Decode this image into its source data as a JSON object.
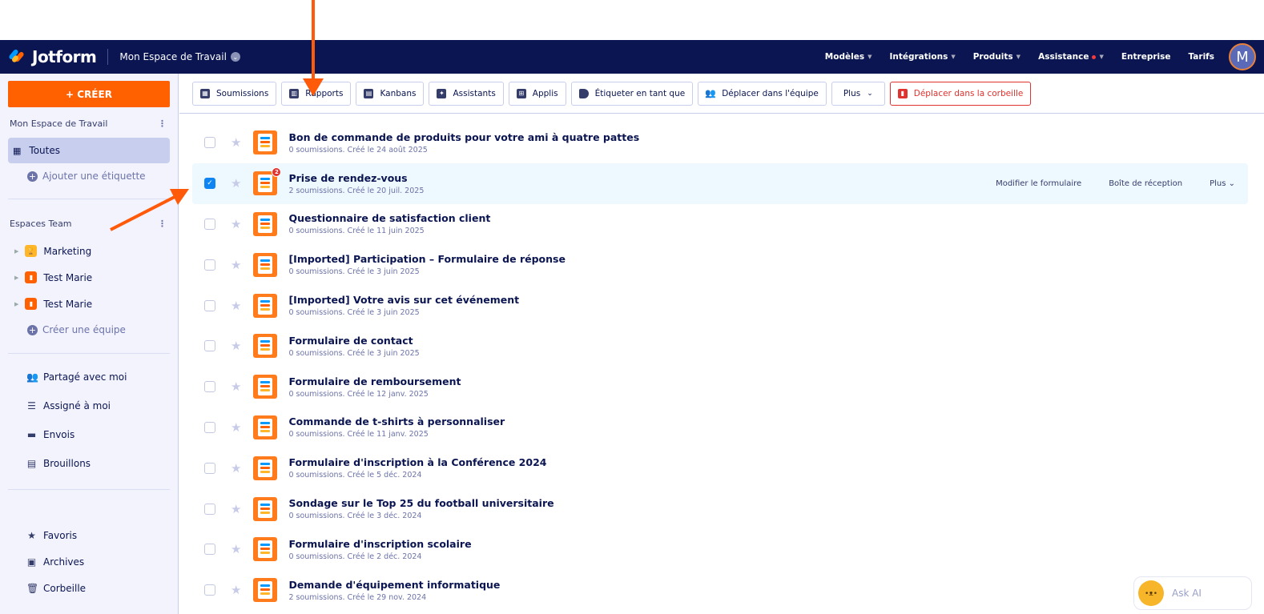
{
  "header": {
    "brand": "Jotform",
    "workspace": "Mon Espace de Travail",
    "nav": [
      "Modèles",
      "Intégrations",
      "Produits",
      "Assistance",
      "Entreprise",
      "Tarifs"
    ],
    "avatar": "M"
  },
  "sidebar": {
    "create": "+ CRÉER",
    "workspace_title": "Mon Espace de Travail",
    "all": "Toutes",
    "add_label": "Ajouter une étiquette",
    "teams_title": "Espaces Team",
    "teams": [
      "Marketing",
      "Test Marie",
      "Test Marie"
    ],
    "create_team": "Créer une équipe",
    "links": [
      "Partagé avec moi",
      "Assigné à moi",
      "Envois",
      "Brouillons"
    ],
    "bottom": [
      "Favoris",
      "Archives",
      "Corbeille"
    ]
  },
  "toolbar": [
    "Soumissions",
    "Rapports",
    "Kanbans",
    "Assistants",
    "Applis",
    "Étiqueter en tant que",
    "Déplacer dans l'équipe",
    "Plus",
    "Déplacer dans la corbeille"
  ],
  "forms": [
    {
      "title": "Bon de commande de produits pour votre ami à quatre pattes",
      "sub": "0 soumissions. Créé le 24 août 2025"
    },
    {
      "title": "Prise de rendez-vous",
      "sub": "2 soumissions. Créé le 20 juil. 2025",
      "badge": "2",
      "selected": true
    },
    {
      "title": "Questionnaire de satisfaction client",
      "sub": "0 soumissions. Créé le 11 juin 2025"
    },
    {
      "title": "[Imported] Participation – Formulaire de réponse",
      "sub": "0 soumissions. Créé le 3 juin 2025"
    },
    {
      "title": "[Imported] Votre avis sur cet événement",
      "sub": "0 soumissions. Créé le 3 juin 2025"
    },
    {
      "title": "Formulaire de contact",
      "sub": "0 soumissions. Créé le 3 juin 2025"
    },
    {
      "title": "Formulaire de remboursement",
      "sub": "0 soumissions. Créé le 12 janv. 2025"
    },
    {
      "title": "Commande de t-shirts à personnaliser",
      "sub": "0 soumissions. Créé le 11 janv. 2025"
    },
    {
      "title": "Formulaire d'inscription à la Conférence 2024",
      "sub": "0 soumissions. Créé le 5 déc. 2024"
    },
    {
      "title": "Sondage sur le Top 25 du football universitaire",
      "sub": "0 soumissions. Créé le 3 déc. 2024"
    },
    {
      "title": "Formulaire d'inscription scolaire",
      "sub": "0 soumissions. Créé le 2 déc. 2024"
    },
    {
      "title": "Demande d'équipement informatique",
      "sub": "2 soumissions. Créé le 29 nov. 2024"
    }
  ],
  "row_actions": [
    "Modifier le formulaire",
    "Boîte de réception",
    "Plus"
  ],
  "ask_ai": "Ask AI",
  "colors": {
    "navy": "#0a1551",
    "orange": "#ff6100",
    "red": "#e0322f",
    "selected": "#edf8ff"
  }
}
